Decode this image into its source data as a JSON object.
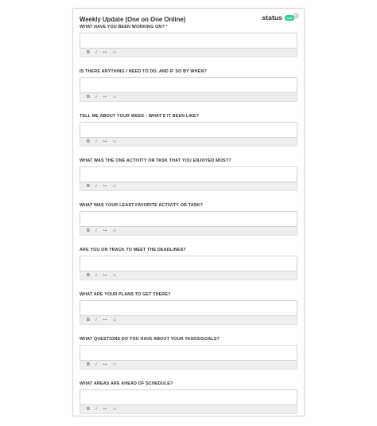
{
  "form": {
    "title": "Weekly Update (One on One Online)",
    "brand": {
      "word": "status",
      "badge": "net"
    },
    "toolbar": {
      "bold": "B",
      "italic": "I",
      "link": "⊶",
      "emoji": "☺"
    },
    "required_mark": "*",
    "fields": [
      {
        "label": "WHAT HAVE YOU BEEN WORKING ON?",
        "required": true,
        "value": ""
      },
      {
        "label": "IS THERE ANYTHING I NEED TO DO, AND IF SO BY WHEN?",
        "required": false,
        "value": ""
      },
      {
        "label": "TELL ME ABOUT YOUR WEEK - WHAT'S IT BEEN LIKE?",
        "required": false,
        "value": ""
      },
      {
        "label": "WHAT WAS THE ONE ACTIVITY OR TASK THAT YOU ENJOYED MOST?",
        "required": false,
        "value": ""
      },
      {
        "label": "WHAT WAS YOUR LEAST FAVORITE ACTIVITY OR TASK?",
        "required": false,
        "value": ""
      },
      {
        "label": "ARE YOU ON TRACK TO MEET THE DEADLINES?",
        "required": false,
        "value": ""
      },
      {
        "label": "WHAT ARE YOUR PLANS TO GET THERE?",
        "required": false,
        "value": ""
      },
      {
        "label": "WHAT QUESTIONS DO YOU HAVE ABOUT YOUR TASKS/GOALS?",
        "required": false,
        "value": ""
      },
      {
        "label": "WHAT AREAS ARE AHEAD OF SCHEDULE?",
        "required": false,
        "value": ""
      }
    ]
  },
  "colors": {
    "accent": "#2ecc8f",
    "required": "#e0473b",
    "toolbar_bg": "#eeeeee",
    "border": "#d3d3d3"
  }
}
